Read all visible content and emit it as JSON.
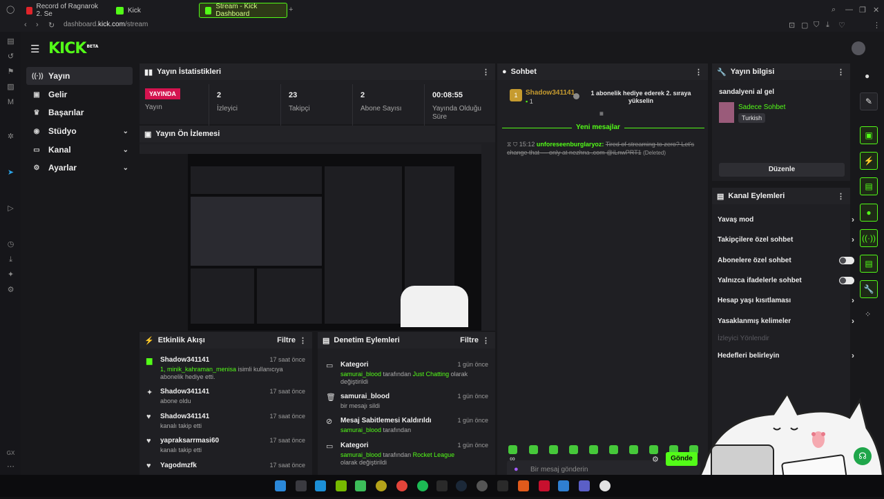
{
  "browser": {
    "tabs": [
      {
        "label": "Record of Ragnarok 2. Se",
        "color": "#e0242a"
      },
      {
        "label": "Kick",
        "color": "#53fc18"
      },
      {
        "label": "Stream - Kick Dashboard",
        "color": "#53fc18"
      }
    ],
    "url_prefix": "dashboard.",
    "url_host": "kick.com",
    "url_path": "/stream"
  },
  "logo": {
    "text": "KICK",
    "badge": "BETA"
  },
  "sidebar": {
    "items": [
      {
        "label": "Yayın",
        "icon": "broadcast-icon"
      },
      {
        "label": "Gelir",
        "icon": "wallet-icon"
      },
      {
        "label": "Başarılar",
        "icon": "trophy-icon"
      },
      {
        "label": "Stüdyo",
        "icon": "studio-icon"
      },
      {
        "label": "Kanal",
        "icon": "channel-icon"
      },
      {
        "label": "Ayarlar",
        "icon": "gear-icon"
      }
    ]
  },
  "stats": {
    "title": "Yayın İstatistikleri",
    "live_badge": "YAYINDA",
    "items": [
      {
        "value": "",
        "label": "Yayın"
      },
      {
        "value": "2",
        "label": "İzleyici"
      },
      {
        "value": "23",
        "label": "Takipçi"
      },
      {
        "value": "2",
        "label": "Abone Sayısı"
      },
      {
        "value": "00:08:55",
        "label": "Yayında Olduğu Süre"
      }
    ]
  },
  "preview": {
    "title": "Yayın Ön İzlemesi"
  },
  "activity": {
    "title": "Etkinlik Akışı",
    "filter": "Filtre",
    "items": [
      {
        "user": "Shadow341141",
        "time": "17 saat önce",
        "prefix": "1, ",
        "highlight": "minik_kahraman_menisa",
        "text": " isimli kullanıcıya abonelik hediye etti."
      },
      {
        "user": "Shadow341141",
        "time": "17 saat önce",
        "text": "abone oldu"
      },
      {
        "user": "Shadow341141",
        "time": "17 saat önce",
        "text": "kanalı takip etti"
      },
      {
        "user": "yapraksarrmasi60",
        "time": "17 saat önce",
        "text": "kanalı takip etti"
      },
      {
        "user": "Yagodmzfk",
        "time": "17 saat önce",
        "text": ""
      }
    ]
  },
  "moderation": {
    "title": "Denetim Eylemleri",
    "filter": "Filtre",
    "items": [
      {
        "title": "Kategori",
        "time": "1 gün önce",
        "actor": "samurai_blood",
        "mid": " tarafından ",
        "target": "Just Chatting",
        "suffix": " olarak değiştirildi"
      },
      {
        "title": "samurai_blood",
        "time": "1 gün önce",
        "text": "bir mesajı sildi"
      },
      {
        "title": "Mesaj Sabitlemesi Kaldırıldı",
        "time": "1 gün önce",
        "actor": "samurai_blood",
        "mid": " tarafından"
      },
      {
        "title": "Kategori",
        "time": "1 gün önce",
        "actor": "samurai_blood",
        "mid": " tarafından ",
        "target": "Rocket League",
        "suffix": " olarak değiştirildi"
      }
    ]
  },
  "chat": {
    "title": "Sohbet",
    "pinned_user": "Shadow341141",
    "pinned_count": "1",
    "pinned_badge": "1",
    "pinned_text": "1 abonelik hediye ederek 2. sıraya yükselin",
    "new_messages": "Yeni mesajlar",
    "message": {
      "time": "15:12",
      "user": "unforeseenburglaryoz:",
      "text": "Tired of streaming to zero? Let's change that — only at nezhna .com @iLnwPRT1",
      "deleted": "(Deleted)"
    },
    "input_placeholder": "Bir mesaj gönderin",
    "send_label": "Gönde"
  },
  "stream_info": {
    "title": "Yayın bilgisi",
    "stream_title": "sandalyeni al gel",
    "category": "Sadece Sohbet",
    "language": "Turkish",
    "edit_button": "Düzenle"
  },
  "channel_actions": {
    "title": "Kanal Eylemleri",
    "items": [
      {
        "label": "Yavaş mod",
        "kind": "arrow"
      },
      {
        "label": "Takipçilere özel sohbet",
        "kind": "arrow"
      },
      {
        "label": "Abonelere özel sohbet",
        "kind": "toggle"
      },
      {
        "label": "Yalnızca ifadelerle sohbet",
        "kind": "toggle"
      },
      {
        "label": "Hesap yaşı kısıtlaması",
        "kind": "arrow"
      },
      {
        "label": "Yasaklanmış kelimeler",
        "kind": "arrow"
      },
      {
        "label": "İzleyici Yönlendir",
        "kind": "disabled"
      },
      {
        "label": "Hedefleri belirleyin",
        "kind": "arrow"
      }
    ]
  },
  "colors": {
    "accent": "#53fc18",
    "live": "#d4134f",
    "panel": "#1f1f23"
  }
}
